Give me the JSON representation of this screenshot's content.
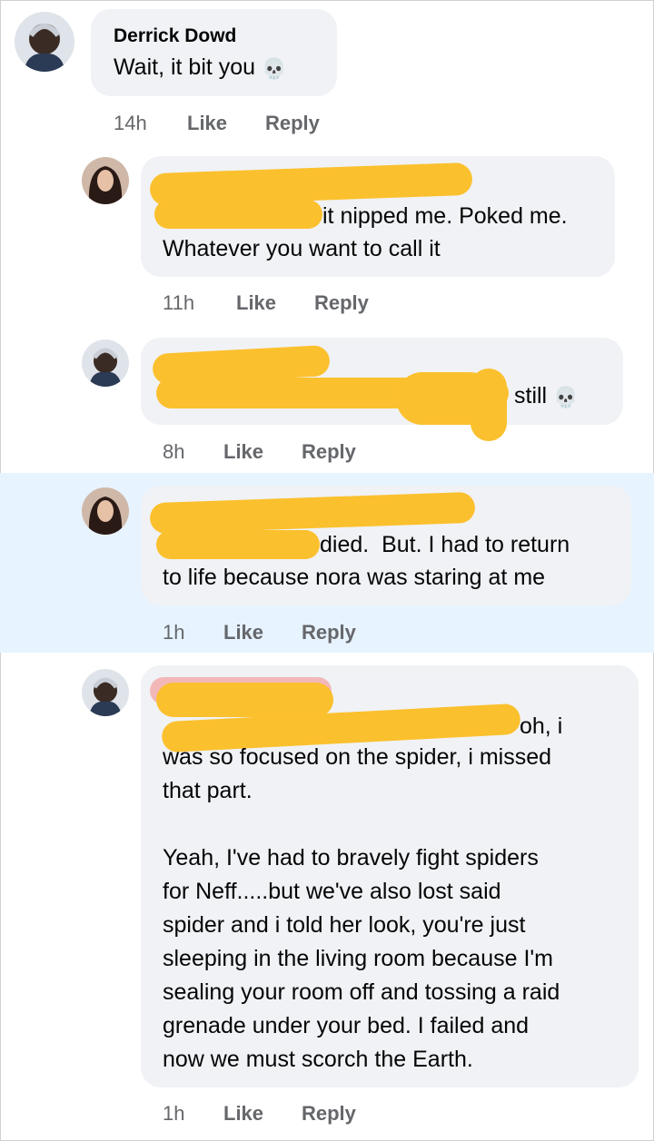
{
  "comments": [
    {
      "author": "Derrick Dowd",
      "text_line": "Wait, it bit you",
      "emoji": "💀",
      "time": "14h",
      "like": "Like",
      "reply": "Reply"
    },
    {
      "text_tail": "it nipped me. Poked me.",
      "text_line2": "Whatever you want to call it",
      "time": "11h",
      "like": "Like",
      "reply": "Reply"
    },
    {
      "text_tail": "still",
      "emoji": "💀",
      "time": "8h",
      "like": "Like",
      "reply": "Reply"
    },
    {
      "text_tail": "died.  But. I had to return",
      "text_line2": "to life because nora was staring at me",
      "time": "1h",
      "like": "Like",
      "reply": "Reply"
    },
    {
      "text_tail": "oh, i",
      "body": "was so focused on the spider, i missed\nthat part.\n\nYeah, I've had to bravely fight spiders\nfor Neff.....but we've also lost said\nspider and i told her look, you're just\nsleeping in the living room because I'm\nsealing your room off and tossing a raid\ngrenade under your bed. I failed and\nnow we must scorch the Earth.",
      "time": "1h",
      "like": "Like",
      "reply": "Reply"
    }
  ],
  "colors": {
    "bubble": "#f0f2f5",
    "highlight": "#e7f3ff",
    "redaction": "#fbc02d",
    "meta": "#65676b"
  }
}
